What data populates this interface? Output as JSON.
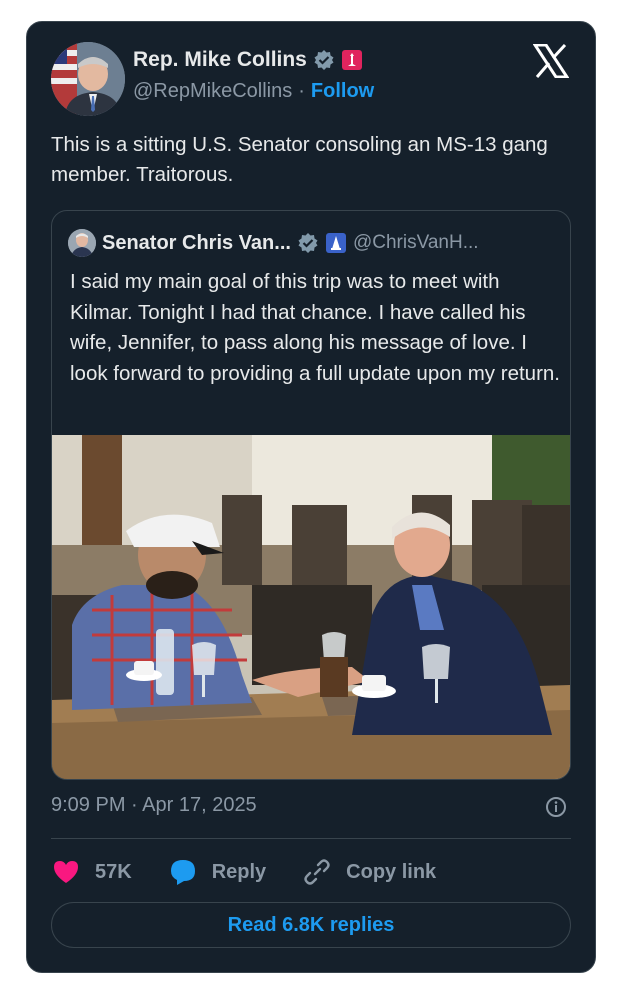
{
  "author": {
    "name": "Rep. Mike Collins",
    "handle": "@RepMikeCollins",
    "separator": "·",
    "follow_label": "Follow"
  },
  "tweet": {
    "text": "This is a sitting U.S. Senator consoling an MS-13 gang member. Traitorous.",
    "timestamp": "9:09 PM · Apr 17, 2025"
  },
  "quoted": {
    "name": "Senator Chris Van...",
    "handle": "@ChrisVanH...",
    "text": "I said my main goal of this trip was to meet with Kilmar. Tonight I had that chance. I have called his wife, Jennifer, to pass along his message of love. I look forward to providing a full update upon my return."
  },
  "actions": {
    "like_count": "57K",
    "reply_label": "Reply",
    "copy_label": "Copy link",
    "read_replies_label": "Read 6.8K replies"
  },
  "colors": {
    "background": "#15202b",
    "accent": "#1d9bf0",
    "like": "#f91880",
    "muted": "#8b98a5",
    "border": "#38444d"
  },
  "icons": [
    "x-logo-icon",
    "verified-icon",
    "house-seal-icon",
    "senate-seal-icon",
    "heart-icon",
    "reply-icon",
    "link-icon",
    "info-icon"
  ]
}
